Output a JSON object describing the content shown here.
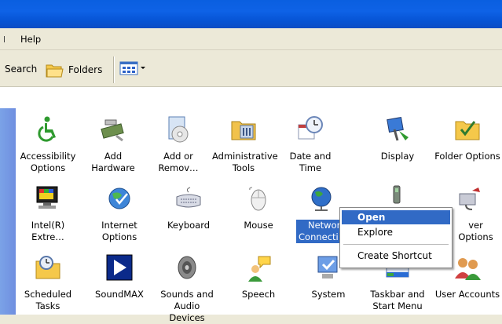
{
  "menubar": {
    "help": "Help"
  },
  "toolbar": {
    "search": "Search",
    "folders": "Folders"
  },
  "items": [
    {
      "line1": "Accessibility",
      "line2": "Options",
      "icon": "accessibility-icon"
    },
    {
      "line1": "Add Hardware",
      "line2": "",
      "icon": "add-hardware-icon"
    },
    {
      "line1": "Add or",
      "line2": "Remov…",
      "icon": "add-remove-programs-icon"
    },
    {
      "line1": "Administrative",
      "line2": "Tools",
      "icon": "administrative-tools-icon"
    },
    {
      "line1": "Date and Time",
      "line2": "",
      "icon": "date-time-icon"
    },
    {
      "line1": "Display",
      "line2": "",
      "icon": "display-icon"
    },
    {
      "line1": "Folder Options",
      "line2": "",
      "icon": "folder-options-icon"
    },
    {
      "line1": "Intel(R)",
      "line2": "Extre…",
      "icon": "intel-graphics-icon"
    },
    {
      "line1": "Internet",
      "line2": "Options",
      "icon": "internet-options-icon"
    },
    {
      "line1": "Keyboard",
      "line2": "",
      "icon": "keyboard-icon"
    },
    {
      "line1": "Mouse",
      "line2": "",
      "icon": "mouse-icon"
    },
    {
      "line1": "Networ",
      "line2": "Connecti",
      "icon": "network-connections-icon"
    },
    {
      "line1": "",
      "line2": "",
      "icon": "phone-modem-icon"
    },
    {
      "line1": "ver Options",
      "line2": "",
      "icon": "power-options-icon"
    },
    {
      "line1": "Scheduled",
      "line2": "Tasks",
      "icon": "scheduled-tasks-icon"
    },
    {
      "line1": "SoundMAX",
      "line2": "",
      "icon": "soundmax-icon"
    },
    {
      "line1": "Sounds and",
      "line2": "Audio Devices",
      "icon": "sounds-audio-icon"
    },
    {
      "line1": "Speech",
      "line2": "",
      "icon": "speech-icon"
    },
    {
      "line1": "System",
      "line2": "",
      "icon": "system-icon"
    },
    {
      "line1": "Taskbar and",
      "line2": "Start Menu",
      "icon": "taskbar-start-menu-icon"
    },
    {
      "line1": "User Accounts",
      "line2": "",
      "icon": "user-accounts-icon"
    }
  ],
  "context_menu": {
    "open": "Open",
    "explore": "Explore",
    "create_shortcut": "Create Shortcut"
  }
}
